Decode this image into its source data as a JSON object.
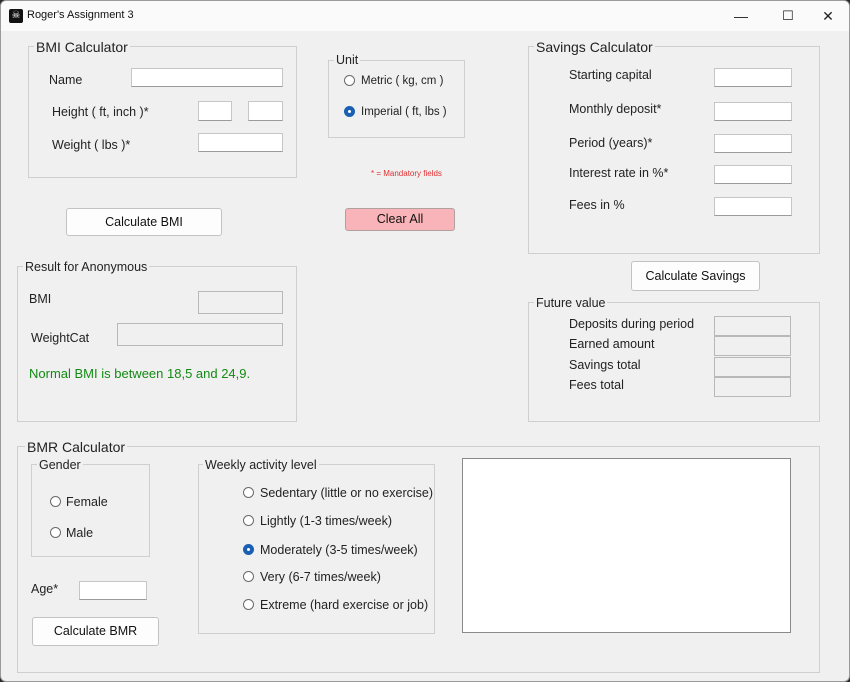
{
  "window": {
    "title": "Roger's Assignment 3",
    "minimize_glyph": "—",
    "maximize_glyph": "☐",
    "close_glyph": "✕",
    "icon": "skull-icon"
  },
  "bmi": {
    "group_title": "BMI Calculator",
    "name_label": "Name",
    "height_label": "Height ( ft, inch )*",
    "weight_label": "Weight ( lbs )*",
    "name_value": "",
    "height_ft_value": "",
    "height_inch_value": "",
    "weight_value": ""
  },
  "unit": {
    "group_title": "Unit",
    "metric_label": "Metric ( kg, cm )",
    "imperial_label": "Imperial ( ft, lbs )",
    "selected": "Imperial"
  },
  "mandatory_note": "* = Mandatory fields",
  "buttons": {
    "calculate_bmi": "Calculate BMI",
    "clear_all": "Clear All",
    "calculate_savings": "Calculate Savings",
    "calculate_bmr": "Calculate BMR"
  },
  "result": {
    "group_title": "Result for Anonymous",
    "bmi_label": "BMI",
    "weightcat_label": "WeightCat",
    "bmi_value": "",
    "weightcat_value": "",
    "normal_text": "Normal BMI is between 18,5 and 24,9."
  },
  "savings": {
    "group_title": "Savings Calculator",
    "starting_capital_label": "Starting capital",
    "monthly_deposit_label": "Monthly deposit*",
    "period_label": "Period (years)*",
    "interest_label": "Interest rate in %*",
    "fees_label": "Fees in %"
  },
  "future": {
    "group_title": "Future value",
    "deposits_label": "Deposits during period",
    "earned_label": "Earned amount",
    "total_label": "Savings total",
    "fees_total_label": "Fees total"
  },
  "bmr": {
    "group_title": "BMR Calculator",
    "gender_title": "Gender",
    "female_label": "Female",
    "male_label": "Male",
    "age_label": "Age*",
    "activity_title": "Weekly activity level",
    "activity_options": [
      "Sedentary (little or no exercise)",
      "Lightly (1-3 times/week)",
      "Moderately (3-5 times/week)",
      "Very (6-7 times/week)",
      "Extreme (hard exercise or job)"
    ],
    "activity_selected": "Moderately (3-5 times/week)",
    "output_text": ""
  },
  "colors": {
    "clear_button_bg": "#f8b4b8",
    "mandatory_text": "#e03030",
    "normal_bmi_text": "#138a13",
    "radio_selected": "#1a5fb4"
  }
}
